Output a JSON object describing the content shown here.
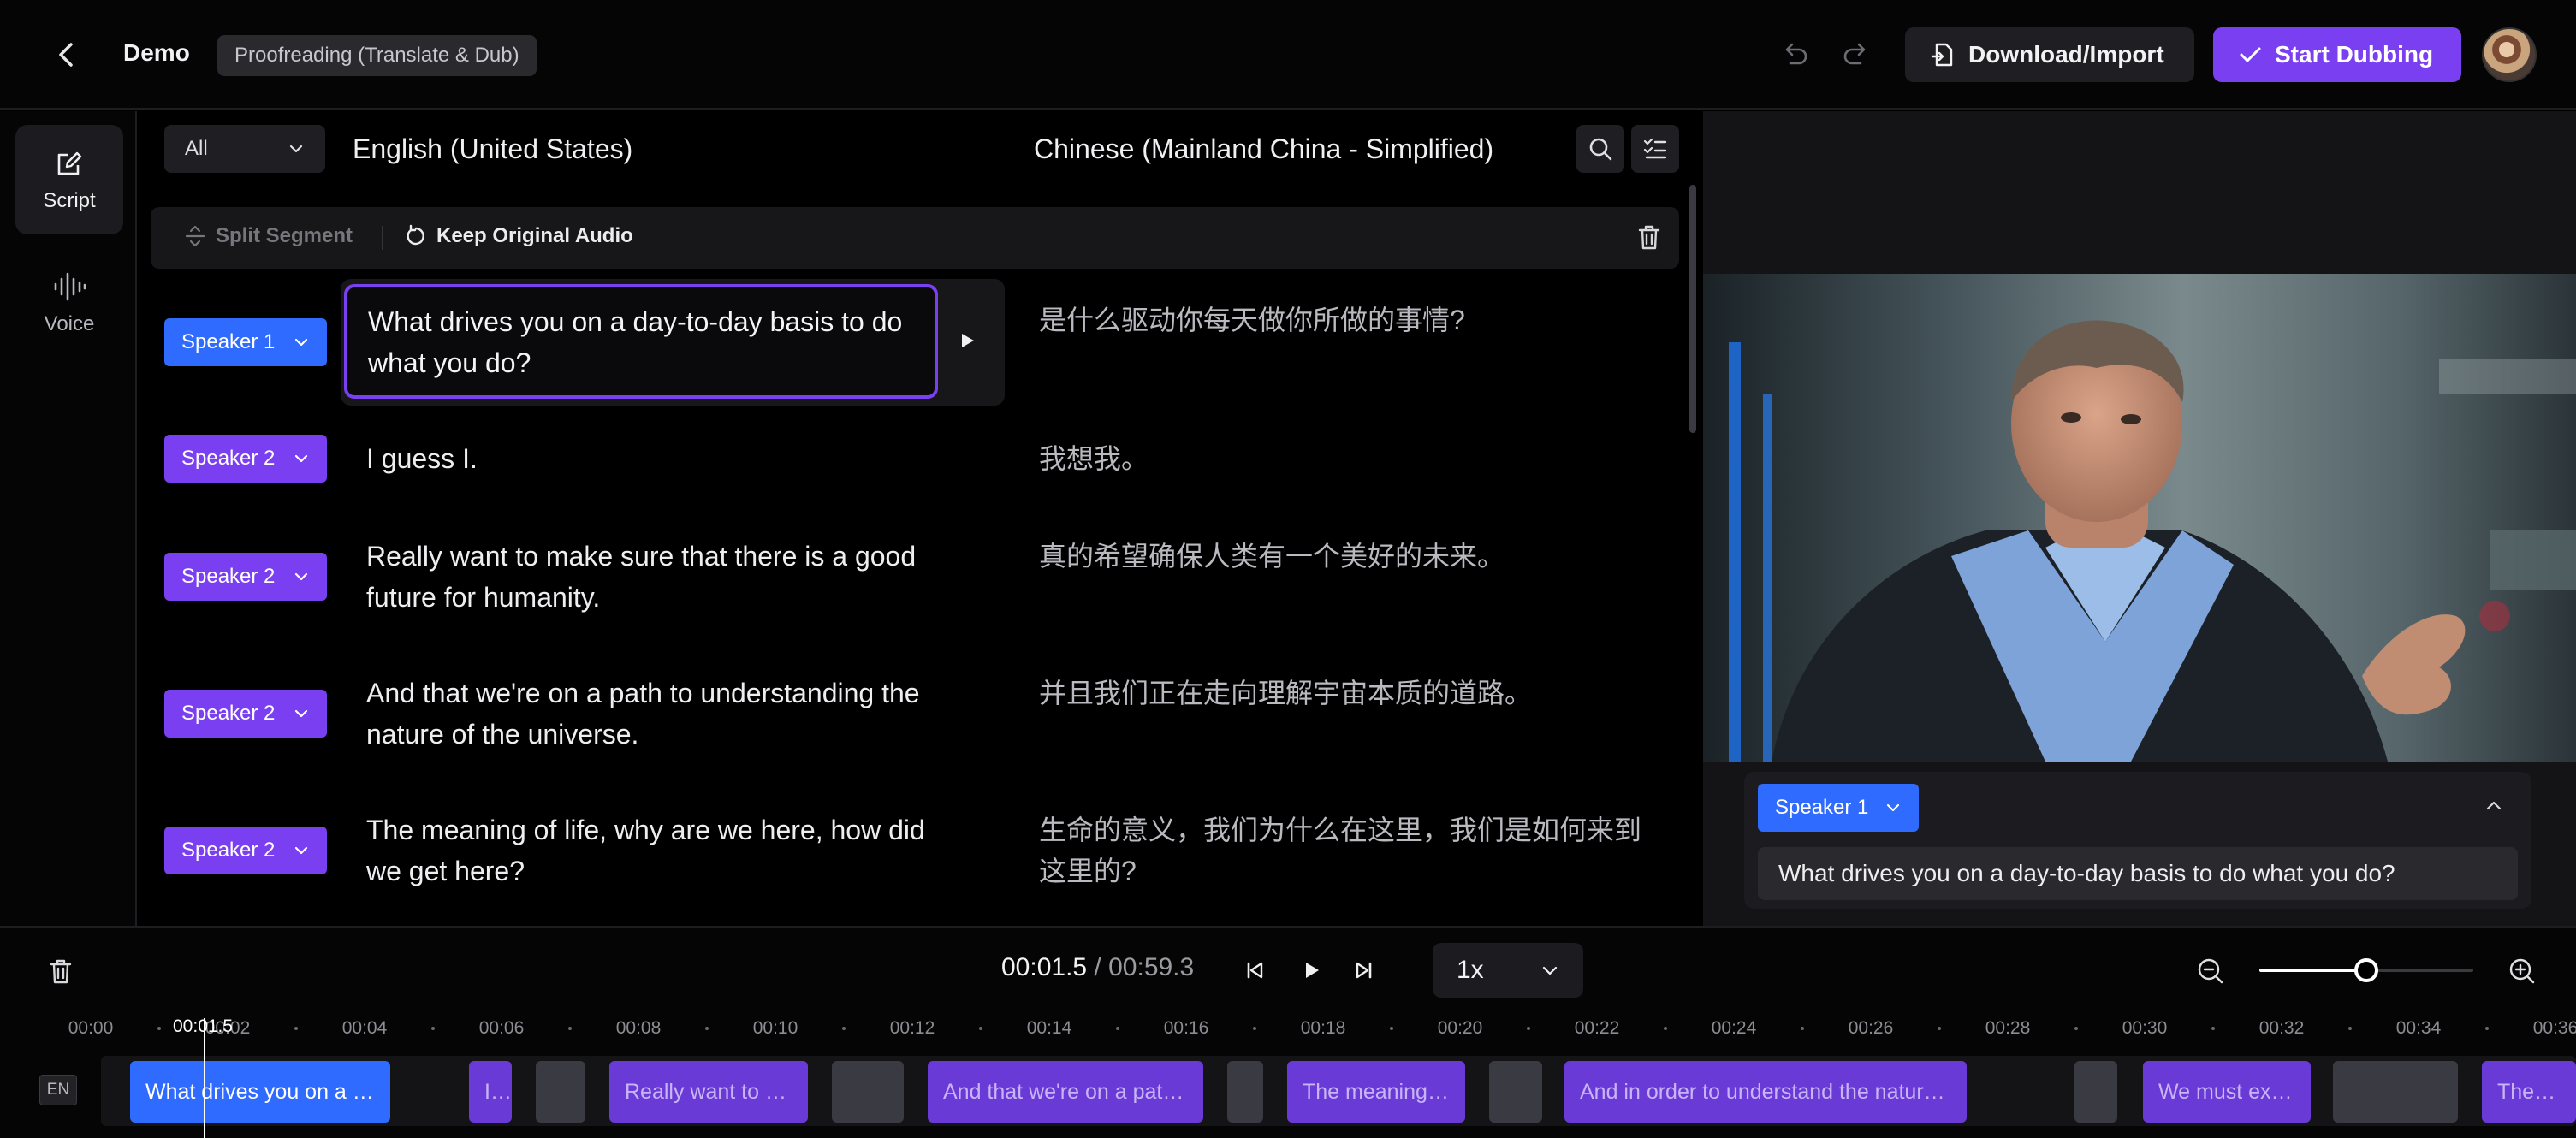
{
  "header": {
    "title": "Demo",
    "mode_badge": "Proofreading (Translate & Dub)",
    "download_label": "Download/Import",
    "start_label": "Start Dubbing"
  },
  "rail": {
    "items": [
      {
        "label": "Script",
        "icon": "edit-icon",
        "active": true
      },
      {
        "label": "Voice",
        "icon": "waveform-icon",
        "active": false
      }
    ]
  },
  "script": {
    "filter_value": "All",
    "source_language": "English (United States)",
    "target_language": "Chinese (Mainland China - Simplified)",
    "split_label": "Split Segment",
    "keep_audio_label": "Keep Original Audio",
    "segments": [
      {
        "speaker": "Speaker 1",
        "text": "What drives you on a day-to-day basis to do what you do?",
        "translation": "是什么驱动你每天做你所做的事情?"
      },
      {
        "speaker": "Speaker 2",
        "text": "I guess I.",
        "translation": "我想我。"
      },
      {
        "speaker": "Speaker 2",
        "text": "Really want to make sure that there is a good future for humanity.",
        "translation": "真的希望确保人类有一个美好的未来。"
      },
      {
        "speaker": "Speaker 2",
        "text": "And that we're on a path to understanding the nature of the universe.",
        "translation": "并且我们正在走向理解宇宙本质的道路。"
      },
      {
        "speaker": "Speaker 2",
        "text": "The meaning of life, why are we here, how did we get here?",
        "translation": "生命的意义，我们为什么在这里，我们是如何来到这里的?"
      }
    ]
  },
  "preview": {
    "speaker": "Speaker 1",
    "subtitle": "What drives you on a day-to-day basis to do what you do?"
  },
  "timeline": {
    "current_time": "00:01.5",
    "total_time": "00:59.3",
    "playback_rate": "1x",
    "zoom_level": 0.5,
    "language_tag": "EN",
    "playhead_label": "00:01.5",
    "ticks": [
      "00:00",
      "00:02",
      "00:04",
      "00:06",
      "00:08",
      "00:10",
      "00:12",
      "00:14",
      "00:16",
      "00:18",
      "00:20",
      "00:22",
      "00:24",
      "00:26",
      "00:28",
      "00:30",
      "00:32",
      "00:34",
      "00:36"
    ],
    "clips": [
      {
        "text": "What drives you on a d...",
        "type": "active"
      },
      {
        "text": "I ...",
        "type": "voice"
      },
      {
        "text": "",
        "type": "gap"
      },
      {
        "text": "Really want to m...",
        "type": "voice"
      },
      {
        "text": "",
        "type": "gap"
      },
      {
        "text": "And that we're on a path...",
        "type": "voice"
      },
      {
        "text": "",
        "type": "gap"
      },
      {
        "text": "The meaning o...",
        "type": "voice"
      },
      {
        "text": "",
        "type": "gap"
      },
      {
        "text": "And in order to understand the nature of the u...",
        "type": "voice"
      },
      {
        "text": "",
        "type": "gap"
      },
      {
        "text": "We must exp...",
        "type": "voice"
      },
      {
        "text": "",
        "type": "gap"
      },
      {
        "text": "There's",
        "type": "voice"
      }
    ]
  },
  "colors": {
    "accent_purple": "#7b3ff2",
    "speaker1_blue": "#2f6bff",
    "panel_dark": "#17171a"
  }
}
